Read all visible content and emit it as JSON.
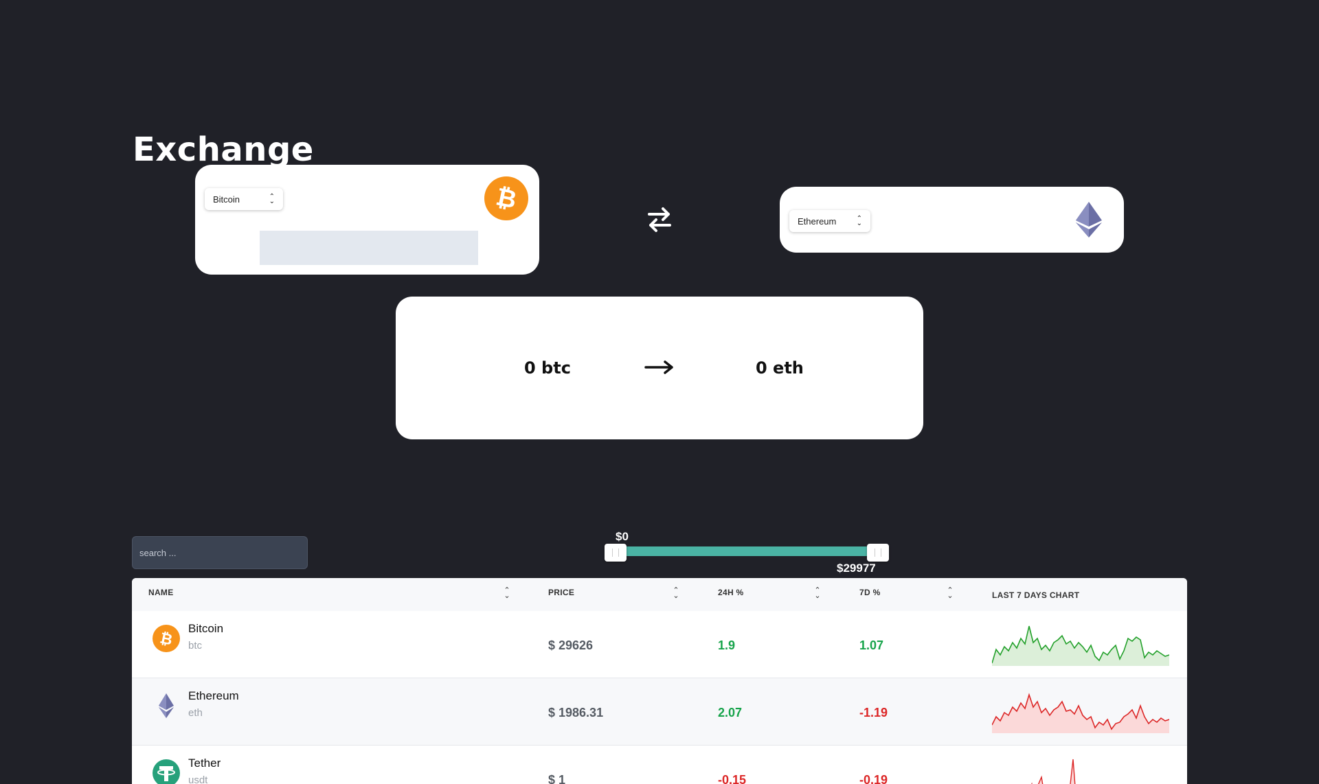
{
  "page": {
    "title": "Exchange"
  },
  "converter": {
    "from": {
      "selected": "Bitcoin",
      "icon": "bitcoin-icon",
      "color": "#f7931a"
    },
    "to": {
      "selected": "Ethereum",
      "icon": "ethereum-icon",
      "color": "#6b6fa5"
    },
    "swap_icon": "swap-arrows-icon",
    "result": {
      "from_text": "0 btc",
      "to_text": "0 eth",
      "arrow_icon": "right-arrow-icon"
    }
  },
  "filters": {
    "search_placeholder": "search ...",
    "price_range": {
      "min_label": "$0",
      "max_label": "$29977",
      "min": 0,
      "max": 29977,
      "accent": "#4ab3a4"
    }
  },
  "table": {
    "columns": [
      "NAME",
      "PRICE",
      "24H %",
      "7D %",
      "LAST 7 DAYS CHART"
    ],
    "rows": [
      {
        "name": "Bitcoin",
        "symbol": "btc",
        "price": "$ 29626",
        "change_24h": "1.9",
        "change_7d": "1.07",
        "trend": "up",
        "icon": "bitcoin-icon"
      },
      {
        "name": "Ethereum",
        "symbol": "eth",
        "price": "$ 1986.31",
        "change_24h": "2.07",
        "change_7d": "-1.19",
        "trend": "down",
        "icon": "ethereum-icon"
      },
      {
        "name": "Tether",
        "symbol": "usdt",
        "price": "$ 1",
        "change_24h": "-0.15",
        "change_7d": "-0.19",
        "trend": "down",
        "icon": "tether-icon"
      }
    ]
  },
  "colors": {
    "background": "#202128",
    "positive": "#16a34a",
    "negative": "#dc2626"
  }
}
